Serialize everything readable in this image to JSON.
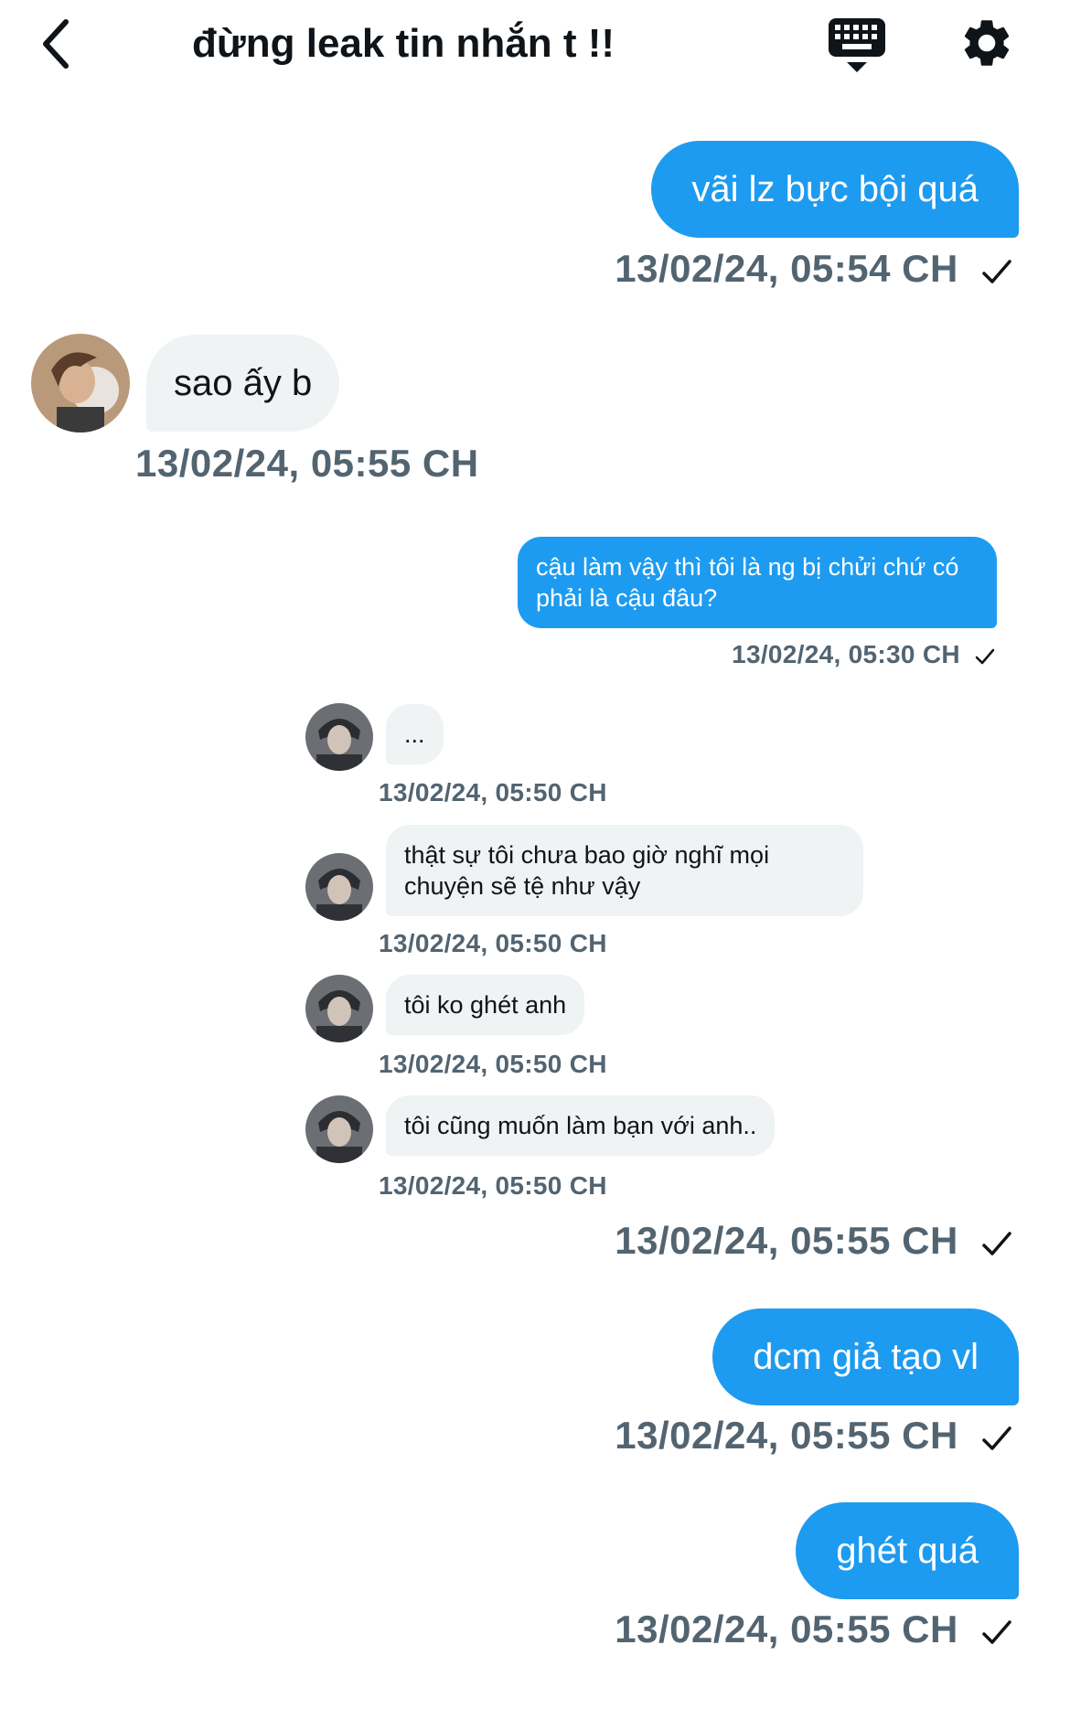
{
  "header": {
    "title": "đừng leak tin nhắn t !!",
    "icons": [
      "back-arrow-icon",
      "keyboard-icon",
      "gear-icon"
    ]
  },
  "colors": {
    "outgoing_bubble": "#1d9bf0",
    "incoming_bubble": "#eff3f4",
    "timestamp": "#536471"
  },
  "messages": [
    {
      "direction": "outgoing",
      "text": "vãi lz bực bội quá",
      "time": "13/02/24, 05:54 CH",
      "read": true
    },
    {
      "direction": "incoming",
      "text": "sao ấy b",
      "time": "13/02/24, 05:55 CH"
    }
  ],
  "embedded": {
    "messages": [
      {
        "direction": "outgoing",
        "text": "cậu làm vậy thì tôi là ng bị chửi chứ có phải là cậu đâu?",
        "time": "13/02/24, 05:30 CH",
        "read": true
      },
      {
        "direction": "incoming",
        "text": "...",
        "time": "13/02/24, 05:50 CH"
      },
      {
        "direction": "incoming",
        "text": "thật sự tôi chưa bao giờ nghĩ mọi chuyện sẽ tệ như vậy",
        "time": "13/02/24, 05:50 CH"
      },
      {
        "direction": "incoming",
        "text": "tôi ko ghét anh",
        "time": "13/02/24, 05:50 CH"
      },
      {
        "direction": "incoming",
        "text": "tôi cũng muốn làm bạn với anh..",
        "time": "13/02/24, 05:50 CH"
      }
    ],
    "time": "13/02/24, 05:55 CH"
  },
  "later_messages": [
    {
      "direction": "outgoing",
      "text": "dcm giả tạo vl",
      "time": "13/02/24, 05:55 CH",
      "read": true
    },
    {
      "direction": "outgoing",
      "text": "ghét quá",
      "time": "13/02/24, 05:55 CH",
      "read": true
    }
  ]
}
